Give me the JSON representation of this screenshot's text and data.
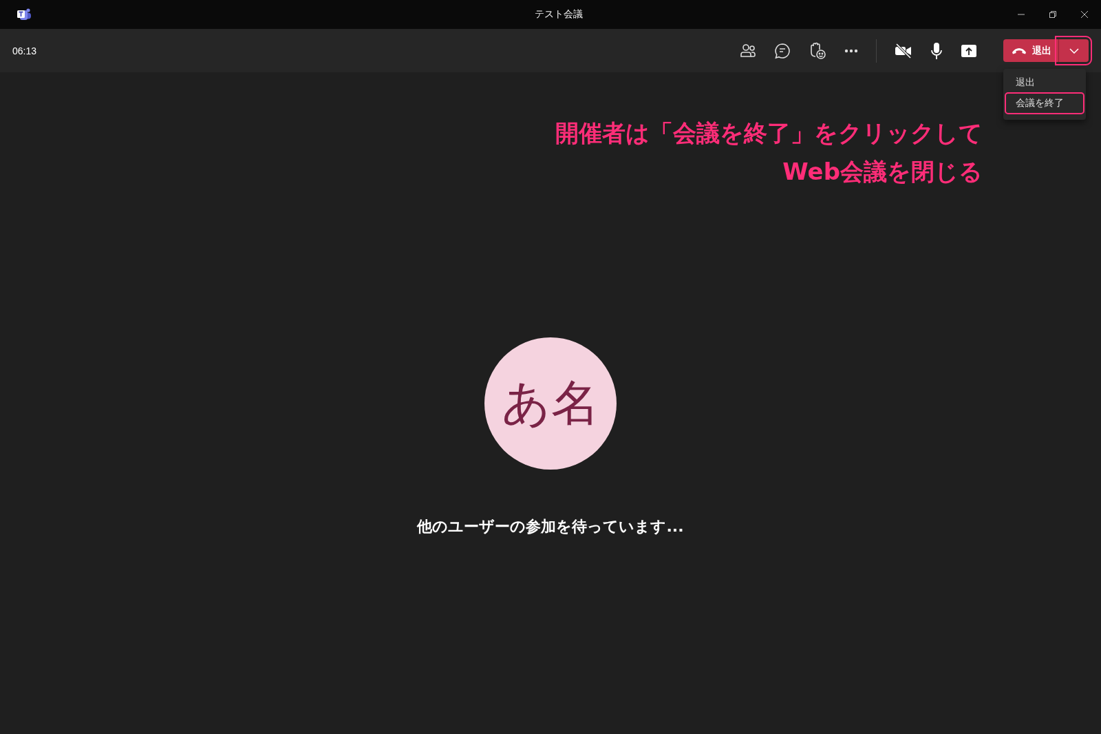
{
  "window": {
    "title": "テスト会議"
  },
  "toolbar": {
    "elapsed": "06:13",
    "leave_button": {
      "label": "退出",
      "highlighted": false
    },
    "leave_menu_toggle": {
      "highlighted": true,
      "expanded": true
    }
  },
  "leave_menu": [
    {
      "label": "退出",
      "highlighted": false
    },
    {
      "label": "会議を終了",
      "highlighted": true
    }
  ],
  "annotation": [
    "開催者は「会議を終了」をクリックして",
    "Web会議を閉じる"
  ],
  "avatar": {
    "initials": "あ名"
  },
  "status_message": "他のユーザーの参加を待っています..."
}
